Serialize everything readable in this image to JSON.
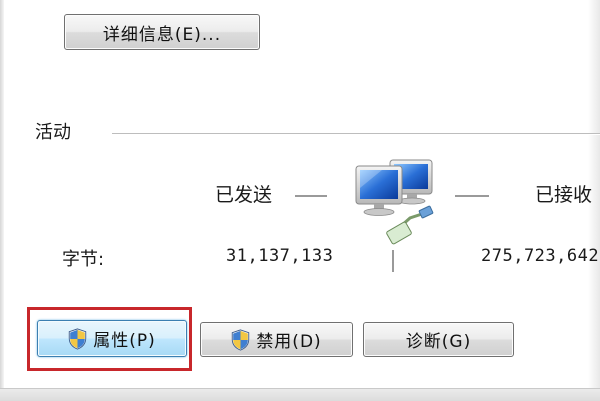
{
  "details_button": {
    "label": "详细信息(E)..."
  },
  "activity": {
    "section_label": "活动",
    "sent_label": "已发送",
    "received_label": "已接收",
    "bytes_label": "字节:",
    "bytes_sent": "31,137,133",
    "bytes_received": "275,723,642"
  },
  "buttons": {
    "properties": "属性(P)",
    "disable": "禁用(D)",
    "diagnose": "诊断(G)"
  },
  "icons": {
    "network": "network-computers-icon",
    "shield": "uac-shield-icon"
  },
  "colors": {
    "highlight_border": "#c8272b",
    "primary_button": "#bee6fd",
    "button_face": "#e6e6e6"
  }
}
